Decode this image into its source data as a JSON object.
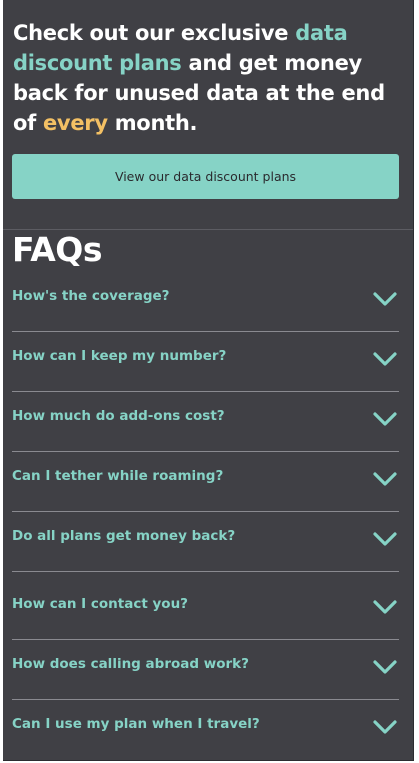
{
  "promo": {
    "text_1": "Check out our exclusive ",
    "highlight_1": "data discount plans",
    "text_2": " and get money back for unused data at the end of ",
    "highlight_2": "every",
    "text_3": " month."
  },
  "cta": {
    "label": "View our data discount plans"
  },
  "faq": {
    "title": "FAQs",
    "items": [
      {
        "question": "How's the coverage?"
      },
      {
        "question": "How can I keep my number?"
      },
      {
        "question": "How much do add-ons cost?"
      },
      {
        "question": "Can I tether while roaming?"
      },
      {
        "question": "Do all plans get money back?"
      },
      {
        "question": "How can I contact you?"
      },
      {
        "question": "How does calling abroad work?"
      },
      {
        "question": "Can I use my plan when I travel?"
      }
    ]
  },
  "colors": {
    "background": "#404045",
    "accent_teal": "#86d3c6",
    "accent_gold": "#f3c064",
    "text_white": "#ffffff"
  },
  "icons": {
    "faq_toggle": "chevron-down-icon"
  }
}
